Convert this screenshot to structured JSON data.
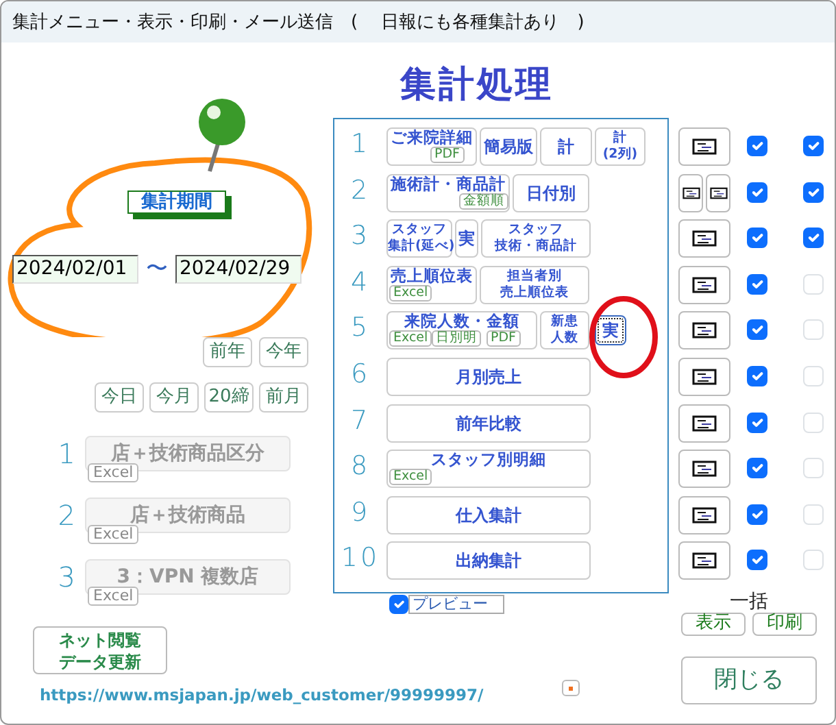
{
  "window": {
    "title": "集計メニュー・表示・印刷・メール送信　(　 日報にも各種集計あり　)"
  },
  "heading": "集計処理",
  "period": {
    "label": "集計期間",
    "start": "2024/02/01",
    "separator": "〜",
    "end": "2024/02/29"
  },
  "year_buttons": [
    "前年",
    "今年"
  ],
  "quick_buttons": [
    "今日",
    "今月",
    "20締",
    "前月"
  ],
  "store_reports": [
    {
      "number": "1",
      "label": "店＋技術商品区分",
      "tag": "Excel",
      "disabled": true
    },
    {
      "number": "2",
      "label": "店＋技術商品",
      "tag": "Excel",
      "disabled": true
    },
    {
      "number": "3",
      "label": "3：VPN 複数店",
      "tag": "Excel",
      "disabled": true
    }
  ],
  "net_update_button": {
    "lines": [
      "ネット閲覧",
      "データ更新"
    ]
  },
  "url": "https://www.msjapan.jp/web_customer/99999997/",
  "reports": [
    {
      "number": "1",
      "buttons": [
        {
          "lines": [
            "ご来院詳細"
          ],
          "focused": false,
          "tags": [
            "PDF"
          ]
        },
        {
          "lines": [
            "簡易版"
          ],
          "focused": false
        },
        {
          "lines": [
            "計"
          ],
          "focused": false
        },
        {
          "lines": [
            "計",
            "(2列)"
          ],
          "focused": false
        }
      ],
      "view_buttons": [
        {
          "kind": "single"
        }
      ],
      "show": true,
      "print": true
    },
    {
      "number": "2",
      "buttons": [
        {
          "lines": [
            "施術計・商品計"
          ],
          "focused": false,
          "tags": [
            "金額順"
          ]
        },
        {
          "lines": [
            "日付別"
          ],
          "focused": false
        }
      ],
      "view_buttons": [
        {
          "kind": "half"
        },
        {
          "kind": "half"
        }
      ],
      "show": true,
      "print": true
    },
    {
      "number": "3",
      "buttons": [
        {
          "lines": [
            "スタッフ",
            "集計(延べ)"
          ],
          "focused": false
        },
        {
          "lines": [
            "実"
          ],
          "focused": false
        },
        {
          "lines": [
            "スタッフ",
            "技術・商品計"
          ],
          "focused": false
        }
      ],
      "view_buttons": [
        {
          "kind": "single"
        }
      ],
      "show": true,
      "print": true
    },
    {
      "number": "4",
      "buttons": [
        {
          "lines": [
            "売上順位表"
          ],
          "focused": false,
          "tags": [
            "Excel"
          ]
        },
        {
          "lines": [
            "担当者別",
            "売上順位表"
          ],
          "focused": false
        }
      ],
      "view_buttons": [
        {
          "kind": "single"
        }
      ],
      "show": true,
      "print": false
    },
    {
      "number": "5",
      "buttons": [
        {
          "lines": [
            "来院人数・金額"
          ],
          "focused": false,
          "tags": [
            "Excel",
            "日別明",
            "PDF"
          ]
        },
        {
          "lines": [
            "新患",
            "人数"
          ],
          "focused": false
        },
        {
          "lines": [
            "実"
          ],
          "focused": true
        }
      ],
      "view_buttons": [
        {
          "kind": "single"
        }
      ],
      "show": true,
      "print": false
    },
    {
      "number": "6",
      "buttons": [
        {
          "lines": [
            "月別売上"
          ],
          "focused": false
        }
      ],
      "view_buttons": [
        {
          "kind": "single"
        }
      ],
      "show": true,
      "print": false
    },
    {
      "number": "7",
      "buttons": [
        {
          "lines": [
            "前年比較"
          ],
          "focused": false
        }
      ],
      "view_buttons": [
        {
          "kind": "single"
        }
      ],
      "show": true,
      "print": false
    },
    {
      "number": "8",
      "buttons": [
        {
          "lines": [
            "スタッフ別明細"
          ],
          "focused": false,
          "tags": [
            "Excel"
          ]
        }
      ],
      "view_buttons": [
        {
          "kind": "single"
        }
      ],
      "show": true,
      "print": false
    },
    {
      "number": "9",
      "buttons": [
        {
          "lines": [
            "仕入集計"
          ],
          "focused": false
        }
      ],
      "view_buttons": [
        {
          "kind": "single"
        }
      ],
      "show": true,
      "print": false
    },
    {
      "number": "10",
      "buttons": [
        {
          "lines": [
            "出納集計"
          ],
          "focused": false
        }
      ],
      "view_buttons": [
        {
          "kind": "single"
        }
      ],
      "show": true,
      "print": false
    }
  ],
  "preview": {
    "label": "プレビュー",
    "checked": true
  },
  "bulk": {
    "label": "一括",
    "buttons": [
      "表示",
      "印刷"
    ]
  },
  "close_button": "閉じる"
}
